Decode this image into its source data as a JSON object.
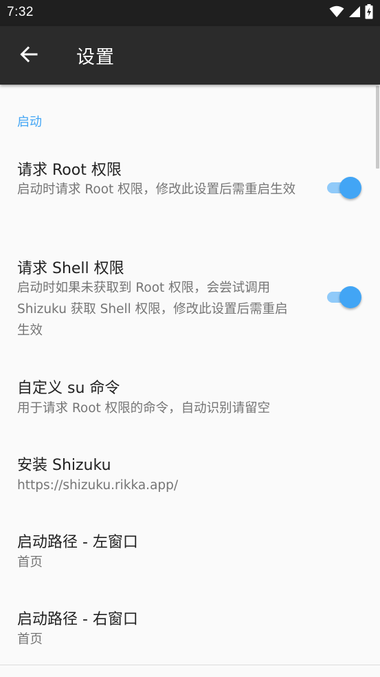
{
  "status_bar": {
    "time": "7:32",
    "icons": [
      "wifi-icon",
      "signal-icon",
      "battery-charging-icon"
    ]
  },
  "app_bar": {
    "back_icon": "arrow-back-icon",
    "title": "设置"
  },
  "settings": {
    "category_startup": "启动",
    "items": [
      {
        "title": "请求 Root 权限",
        "summary": "启动时请求 Root 权限，修改此设置后需重启生效",
        "toggle": true
      },
      {
        "title": "请求 Shell 权限",
        "summary": "启动时如果未获取到 Root 权限，会尝试调用 Shizuku 获取 Shell 权限，修改此设置后需重启生效",
        "toggle": true
      },
      {
        "title": "自定义 su 命令",
        "summary": "用于请求 Root 权限的命令，自动识别请留空"
      },
      {
        "title": "安装 Shizuku",
        "summary": "https://shizuku.rikka.app/"
      },
      {
        "title": "启动路径 - 左窗口",
        "summary": "首页"
      },
      {
        "title": "启动路径 - 右窗口",
        "summary": "首页"
      }
    ]
  },
  "colors": {
    "accent": "#42a5f5",
    "switch_track": "#90caf9",
    "app_bar": "#2b2b2b",
    "status_bar": "#1f1f1f",
    "background": "#fafafa"
  }
}
